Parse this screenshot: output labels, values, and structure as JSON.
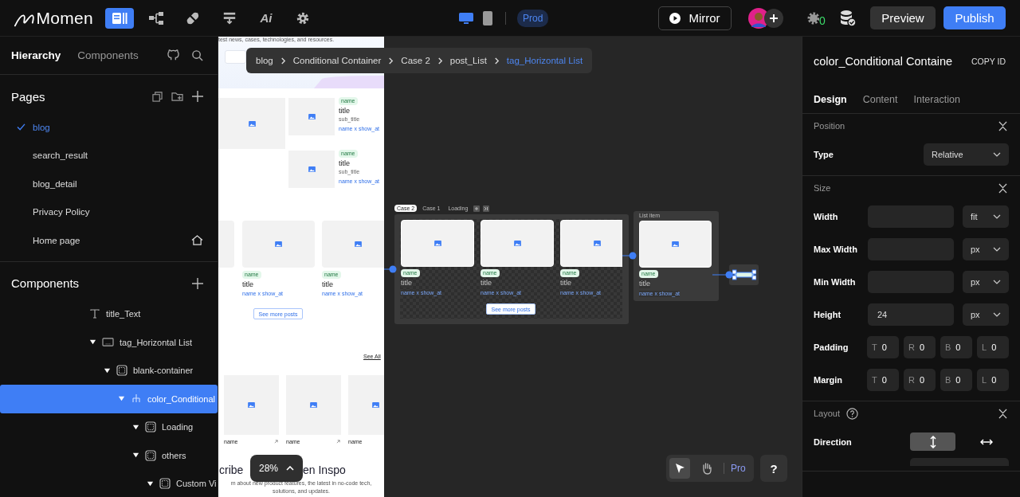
{
  "topbar": {
    "logo": "Momen",
    "nav": [
      {
        "kind": "pages",
        "selected": true
      },
      {
        "kind": "tree",
        "selected": false
      },
      {
        "kind": "plug",
        "selected": false
      },
      {
        "kind": "actions",
        "selected": false
      },
      {
        "kind": "ai",
        "label": "Ai",
        "selected": false
      },
      {
        "kind": "settings",
        "selected": false
      }
    ],
    "devices": [
      {
        "kind": "desktop",
        "selected": true
      },
      {
        "kind": "mobile",
        "selected": false
      }
    ],
    "environment": "Prod",
    "mirror": "Mirror",
    "issues_count": "0",
    "preview": "Preview",
    "publish": "Publish"
  },
  "left_panel": {
    "tabs": [
      {
        "label": "Hierarchy",
        "selected": true
      },
      {
        "label": "Components",
        "selected": false
      }
    ],
    "pages": {
      "title": "Pages",
      "items": [
        {
          "name": "blog",
          "selected": true,
          "home": false
        },
        {
          "name": "search_result",
          "selected": false,
          "home": false
        },
        {
          "name": "blog_detail",
          "selected": false,
          "home": false
        },
        {
          "name": "Privacy Policy",
          "selected": false,
          "home": false
        },
        {
          "name": "Home page",
          "selected": false,
          "home": true
        }
      ]
    },
    "components": {
      "title": "Components",
      "tree": [
        {
          "name": "title_Text",
          "kind": "text",
          "selected": false
        },
        {
          "name": "tag_Horizontal List",
          "kind": "list",
          "selected": false,
          "expanded": true,
          "children": [
            {
              "name": "blank-container",
              "kind": "container",
              "selected": false,
              "expanded": true,
              "children": [
                {
                  "name": "color_Conditional",
                  "kind": "conditional",
                  "selected": true,
                  "expanded": true,
                  "children": [
                    {
                      "name": "Loading",
                      "kind": "container",
                      "selected": false,
                      "expanded": true
                    },
                    {
                      "name": "others",
                      "kind": "container",
                      "selected": false,
                      "expanded": true,
                      "children": [
                        {
                          "name": "Custom Vi",
                          "kind": "container",
                          "selected": false,
                          "expanded": true
                        }
                      ]
                    }
                  ]
                }
              ]
            }
          ]
        }
      ]
    }
  },
  "canvas": {
    "breadcrumb": [
      {
        "label": "blog",
        "current": false
      },
      {
        "label": "Conditional Container",
        "current": false
      },
      {
        "label": "Case 2",
        "current": false
      },
      {
        "label": "post_List",
        "current": false
      },
      {
        "label": "tag_Horizontal List",
        "current": true
      }
    ],
    "preview": {
      "intro": "test news, cases, technologies, and resources.",
      "featured": [
        {
          "tag": "name",
          "title": "title",
          "subtitle": "sub_title",
          "meta": "name x show_at"
        },
        {
          "tag": "name",
          "title": "title",
          "subtitle": "sub_title",
          "meta": "name x show_at"
        }
      ],
      "posts": [
        {
          "tag": "name",
          "title": "title",
          "meta": "name x show_at"
        },
        {
          "tag": "name",
          "title": "title",
          "meta": "name x show_at"
        }
      ],
      "more": "See more posts",
      "see_all": "See All",
      "gallery": [
        {
          "name": "name"
        },
        {
          "name": "name"
        },
        {
          "name": "name"
        }
      ],
      "subscribe_left": "cribe",
      "subscribe_right": "en Inspo",
      "subscribe_text": [
        "m about new product features, the latest in no-code tech,",
        "solutions, and updates."
      ]
    },
    "conditional": {
      "tabs": [
        {
          "label": "Case 2",
          "selected": true
        },
        {
          "label": "Case 1",
          "selected": false
        },
        {
          "label": "Loading",
          "selected": false
        }
      ],
      "cards": [
        {
          "tag": "name",
          "title": "title",
          "meta": "name x show_at"
        },
        {
          "tag": "name",
          "title": "title",
          "meta": "name x show_at"
        },
        {
          "tag": "name",
          "title": "title",
          "meta": "name x show_at"
        }
      ],
      "more": "See more posts"
    },
    "list_item": {
      "label": "List item",
      "tag": "name",
      "title": "title",
      "meta": "name x show_at"
    },
    "zoom": "28%",
    "tools": [
      {
        "kind": "pointer",
        "selected": true
      },
      {
        "kind": "hand",
        "selected": false
      }
    ],
    "plan": "Pro",
    "help": "?"
  },
  "inspector": {
    "title": "color_Conditional Containe",
    "copy_id": "COPY ID",
    "tabs": [
      {
        "label": "Design",
        "selected": true
      },
      {
        "label": "Content",
        "selected": false
      },
      {
        "label": "Interaction",
        "selected": false
      }
    ],
    "sections": [
      {
        "title": "Position",
        "rows": [
          {
            "kind": "select",
            "label": "Type",
            "value": "Relative"
          }
        ]
      },
      {
        "title": "Size",
        "rows": [
          {
            "kind": "size",
            "label": "Width",
            "unit": "fit"
          },
          {
            "kind": "size",
            "label": "Max Width",
            "unit": "px"
          },
          {
            "kind": "size",
            "label": "Min Width",
            "unit": "px"
          },
          {
            "kind": "size",
            "label": "Height",
            "value": "24",
            "unit": "px"
          },
          {
            "kind": "sides",
            "label": "Padding",
            "sides": [
              {
                "side": "T",
                "value": "0"
              },
              {
                "side": "R",
                "value": "0"
              },
              {
                "side": "B",
                "value": "0"
              },
              {
                "side": "L",
                "value": "0"
              }
            ]
          },
          {
            "kind": "sides",
            "label": "Margin",
            "sides": [
              {
                "side": "T",
                "value": "0"
              },
              {
                "side": "R",
                "value": "0"
              },
              {
                "side": "B",
                "value": "0"
              },
              {
                "side": "L",
                "value": "0"
              }
            ]
          }
        ]
      },
      {
        "title": "Layout",
        "help": true,
        "rows": [
          {
            "kind": "direction",
            "label": "Direction",
            "options": [
              {
                "kind": "vertical",
                "selected": true
              },
              {
                "kind": "horizontal",
                "selected": false
              }
            ]
          }
        ]
      }
    ]
  }
}
